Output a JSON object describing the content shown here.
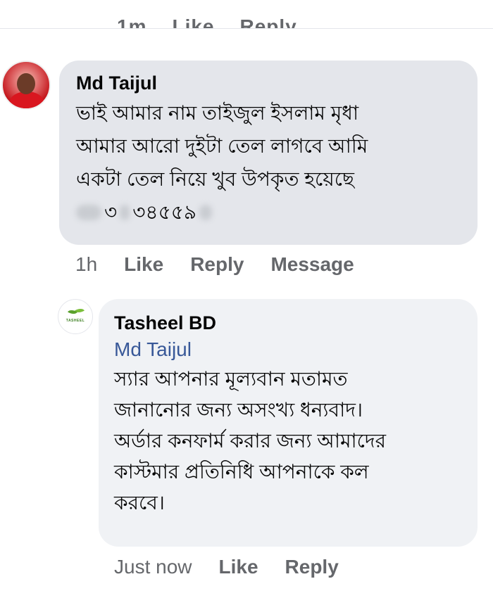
{
  "previous_comment": {
    "actions": [
      "1m",
      "Like",
      "Reply"
    ]
  },
  "comment": {
    "author": "Md Taijul",
    "lines": [
      "ভাই আমার নাম তাইজুল ইসলাম মৃধা",
      "আমার আরো দুইটা তেল লাগবে আমি",
      "একটা তেল নিয়ে খুব উপকৃত হয়েছে"
    ],
    "phone_visible_1": "৩",
    "phone_visible_2": "৩৪৫৫৯",
    "time": "1h",
    "like_label": "Like",
    "reply_label": "Reply",
    "message_label": "Message"
  },
  "reply": {
    "author": "Tasheel BD",
    "avatar_text": "TASHEEL",
    "mention": "Md Taijul",
    "lines": [
      "স্যার আপনার মূল্যবান মতামত",
      "জানানোর জন্য অসংখ্য ধন্যবাদ।",
      "অর্ডার কনফার্ম করার জন্য আমাদের",
      "কাস্টমার প্রতিনিধি আপনাকে কল",
      "করবে।"
    ],
    "time": "Just now",
    "like_label": "Like",
    "reply_label": "Reply"
  },
  "colors": {
    "bubble_comment": "#e4e6eb",
    "bubble_reply": "#f0f2f5",
    "mention": "#385898",
    "meta_text": "#65676b"
  }
}
